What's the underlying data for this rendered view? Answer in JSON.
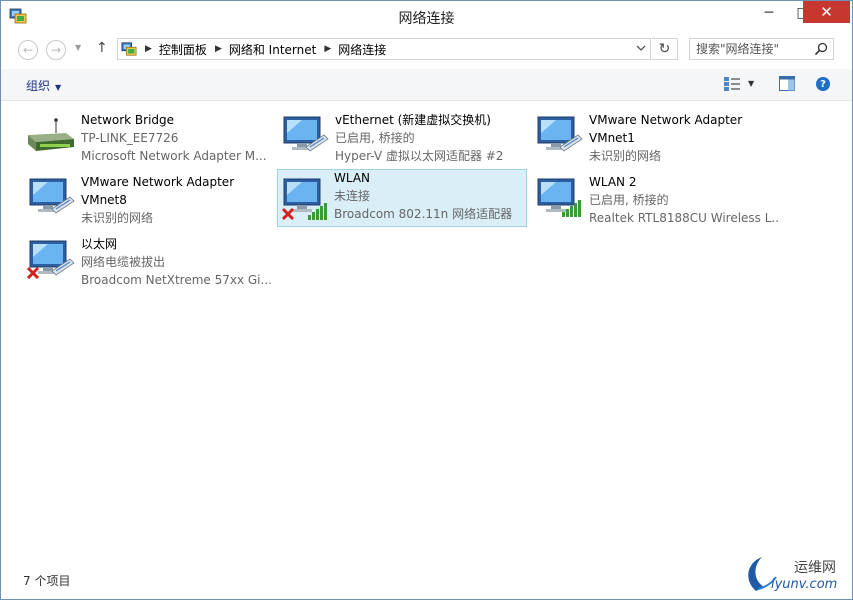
{
  "window": {
    "title": "网络连接",
    "controls": {
      "minimize": "─",
      "maximize": "□",
      "close": "✕"
    }
  },
  "nav": {
    "back": "←",
    "forward": "→",
    "recent": "▼",
    "up": "↑",
    "breadcrumbs": [
      "控制面板",
      "网络和 Internet",
      "网络连接"
    ],
    "refresh": "↻",
    "search_placeholder": "搜索\"网络连接\""
  },
  "toolbar": {
    "organize_label": "组织",
    "caret": "▼"
  },
  "items": [
    {
      "name": "Network Bridge",
      "line2": "TP-LINK_EE7726",
      "line3": "Microsoft Network Adapter M...",
      "icon": "network-bridge-icon"
    },
    {
      "name": "vEthernet (新建虚拟交换机)",
      "line2": "已启用, 桥接的",
      "line3": "Hyper-V 虚拟以太网适配器 #2",
      "icon": "ethernet-adapter-icon"
    },
    {
      "name": "VMware Network Adapter",
      "line2": "VMnet1",
      "line3": "未识别的网络",
      "icon": "ethernet-adapter-icon"
    },
    {
      "name": "VMware Network Adapter",
      "line2": "VMnet8",
      "line3": "未识别的网络",
      "icon": "ethernet-adapter-icon"
    },
    {
      "name": "WLAN",
      "line2": "未连接",
      "line3": "Broadcom 802.11n 网络适配器",
      "icon": "wireless-adapter-disconnected-icon"
    },
    {
      "name": "WLAN 2",
      "line2": "已启用, 桥接的",
      "line3": "Realtek RTL8188CU Wireless L...",
      "icon": "wireless-adapter-icon"
    },
    {
      "name": "以太网",
      "line2": "网络电缆被拔出",
      "line3": "Broadcom NetXtreme 57xx Gi...",
      "icon": "ethernet-disconnected-icon"
    }
  ],
  "status": {
    "item_count": "7 个项目"
  },
  "watermark": {
    "cn": "运维网",
    "en": "iyunv.com"
  },
  "colors": {
    "selection_bg": "#d9eef7",
    "selection_border": "#9fd4e8",
    "close_red": "#c7372f",
    "accent_blue": "#1e3287"
  }
}
